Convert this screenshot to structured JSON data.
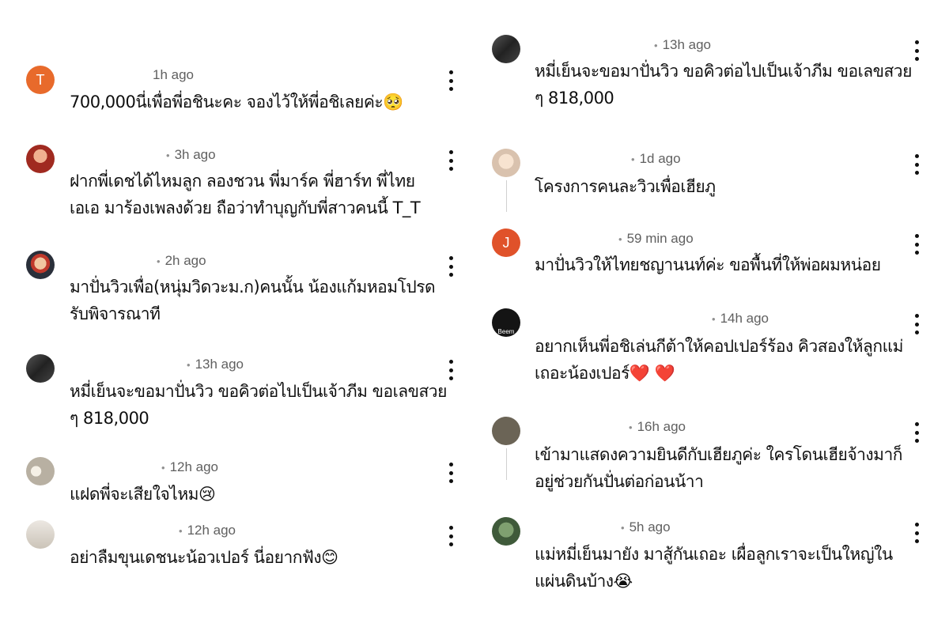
{
  "left_comments": [
    {
      "avatar_letter": "T",
      "avatar_color": "#e86a2b",
      "time": "1h ago",
      "lines": [
        "700,000นี่เพื่อพี่อชินะคะ จองไว้ให้พี่อชิเลยค่ะ🥺"
      ]
    },
    {
      "avatar_letter": "",
      "avatar_color": "#b33a2a",
      "time": "3h ago",
      "lines": [
        "ฝากพี่เดชได้ไหมลูก ลองชวน พี่มาร์ค พี่ฮาร์ท พี่ไทย",
        "เอเอ มาร้องเพลงด้วย ถือว่าทำบุญกับพี่สาวคนนี้ T_T"
      ]
    },
    {
      "avatar_letter": "",
      "avatar_color": "#2a2f3a",
      "time": "2h ago",
      "lines": [
        "มาปั่นวิวเพื่อ(หนุ่มวิดวะม.ก)คนนั้น น้องแก้มหอมโปรด",
        "รับพิจารณาที"
      ]
    },
    {
      "avatar_letter": "",
      "avatar_color": "#3a3a3a",
      "time": "13h ago",
      "lines": [
        "หมี่เย็นจะขอมาปั่นวิว ขอคิวต่อไปเป็นเจ้าภีม ขอเลขสวย",
        "ๆ 818,000"
      ]
    },
    {
      "avatar_letter": "",
      "avatar_color": "#cfc9bd",
      "time": "12h ago",
      "lines": [
        "แฝดพี่จะเสียใจไหม😢"
      ]
    },
    {
      "avatar_letter": "",
      "avatar_color": "#d8d3cb",
      "time": "12h ago",
      "lines": [
        "อย่าลืมขุนเดชนะน้อวเปอร์ นี่อยากฟัง😊"
      ]
    }
  ],
  "right_comments": [
    {
      "avatar_letter": "",
      "avatar_color": "#3a3a3a",
      "time": "13h ago",
      "lines": [
        "หมี่เย็นจะขอมาปั่นวิว ขอคิวต่อไปเป็นเจ้าภีม ขอเลขสวย",
        "ๆ 818,000"
      ]
    },
    {
      "avatar_letter": "",
      "avatar_color": "#e8d5c4",
      "time": "1d ago",
      "lines": [
        "โครงการคนละวิวเพื่อเฮียภู"
      ]
    },
    {
      "avatar_letter": "J",
      "avatar_color": "#e0522a",
      "time": "59 min ago",
      "lines": [
        "มาปั่นวิวให้ไทยชญานนท์ค่ะ ขอพื้นที่ให้พ่อผมหน่อย"
      ]
    },
    {
      "avatar_letter": "Beem",
      "avatar_color": "#141414",
      "time": "14h ago",
      "lines": [
        "อยากเห็นพี่อชิเล่นกีต้าให้คอปเปอร์ร้อง คิวสองให้ลูกแม่",
        "เถอะน้องเปอร์❤️ ❤️"
      ]
    },
    {
      "avatar_letter": "",
      "avatar_color": "#6b6456",
      "time": "16h ago",
      "lines": [
        "เข้ามาแสดงความยินดีกับเฮียภูค่ะ ใครโดนเฮียจ้างมาก็",
        "อยู่ช่วยกันปั่นต่อก่อนน้าา"
      ]
    },
    {
      "avatar_letter": "",
      "avatar_color": "#5f7a5a",
      "time": "5h ago",
      "lines": [
        "แม่หมี่เย็นมายัง มาสู้กันเถอะ เผื่อลูกเราจะเป็นใหญ่ใน",
        "แผ่นดินบ้าง😭"
      ]
    }
  ],
  "icons": {
    "more": "more-vert-icon"
  }
}
